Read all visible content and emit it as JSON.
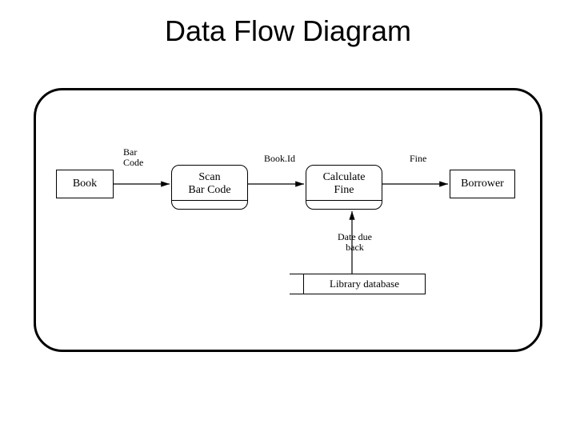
{
  "title": "Data Flow Diagram",
  "entities": {
    "book": "Book",
    "borrower": "Borrower"
  },
  "processes": {
    "scan": "Scan\nBar Code",
    "calc": "Calculate\nFine"
  },
  "datastores": {
    "library": "Library database"
  },
  "flows": {
    "barcode": "Bar\nCode",
    "bookid": "Book.Id",
    "fine": "Fine",
    "datedue": "Date due\nback"
  }
}
